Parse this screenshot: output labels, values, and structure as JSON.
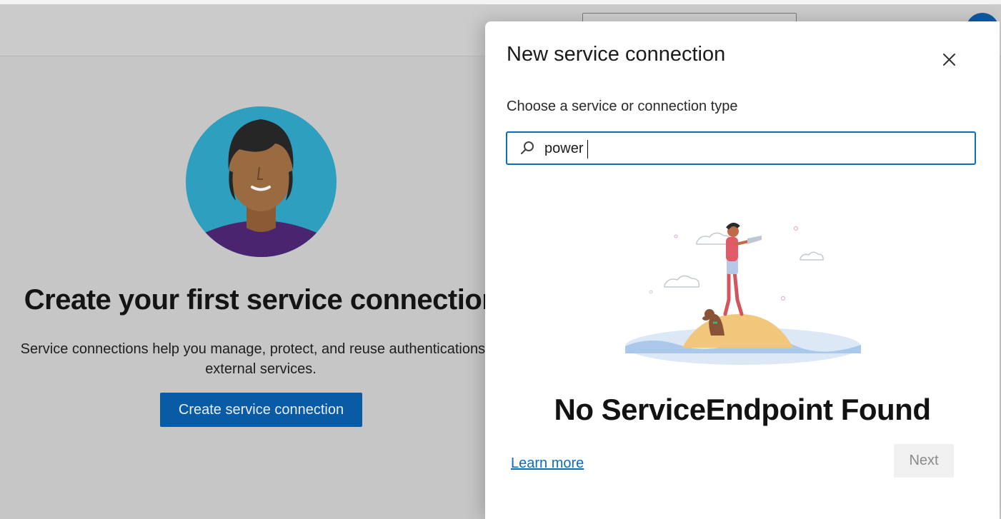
{
  "background": {
    "title": "Create your first service connection",
    "description_line1": "Service connections help you manage, protect, and reuse authentications to",
    "description_line2": "external services.",
    "create_button_label": "Create service connection"
  },
  "dialog": {
    "title": "New service connection",
    "subtitle": "Choose a service or connection type",
    "search_value": "power",
    "empty_title": "No ServiceEndpoint Found",
    "learn_more_label": "Learn more",
    "next_label": "Next"
  },
  "colors": {
    "accent": "#0f6cbd",
    "button_bg": "#0a5ba6",
    "overlay": "#c6c6c6"
  },
  "icons": [
    "close-icon",
    "search-icon"
  ]
}
